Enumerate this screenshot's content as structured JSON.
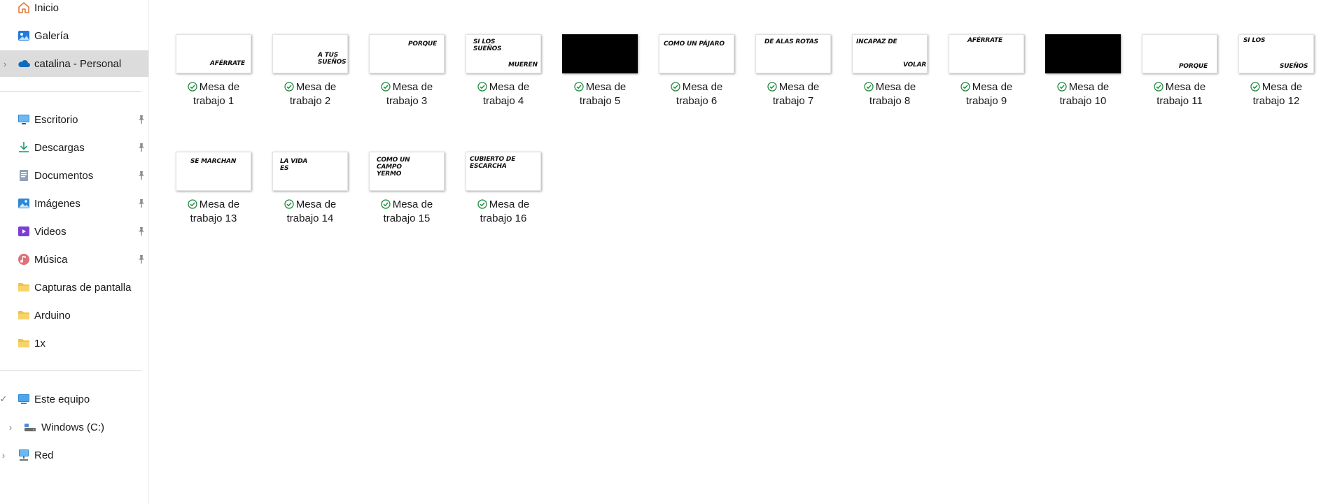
{
  "sidebar": {
    "top_items": [
      {
        "label": "Inicio",
        "icon": "home-icon"
      },
      {
        "label": "Galería",
        "icon": "gallery-icon"
      },
      {
        "label": "catalina - Personal",
        "icon": "onedrive-cloud-icon",
        "selected": true
      }
    ],
    "pinned_items": [
      {
        "label": "Escritorio",
        "icon": "desktop-icon"
      },
      {
        "label": "Descargas",
        "icon": "download-icon"
      },
      {
        "label": "Documentos",
        "icon": "documents-icon"
      },
      {
        "label": "Imágenes",
        "icon": "pictures-icon"
      },
      {
        "label": "Videos",
        "icon": "videos-icon"
      },
      {
        "label": "Música",
        "icon": "music-icon"
      }
    ],
    "folders": [
      {
        "label": "Capturas de pantalla",
        "icon": "folder-icon"
      },
      {
        "label": "Arduino",
        "icon": "folder-icon"
      },
      {
        "label": "1x",
        "icon": "folder-icon"
      }
    ],
    "devices": [
      {
        "label": "Este equipo",
        "icon": "computer-icon",
        "chevron": "✓"
      },
      {
        "label": "Windows (C:)",
        "icon": "drive-icon",
        "chevron": "›"
      },
      {
        "label": "Red",
        "icon": "network-icon",
        "chevron": "›"
      }
    ]
  },
  "files": [
    {
      "name_line1": "Mesa de",
      "name_line2": "trabajo 1",
      "thumb_text": "AFÉRRATE",
      "dark": false
    },
    {
      "name_line1": "Mesa de",
      "name_line2": "trabajo 2",
      "thumb_text": "A TUS\nSUEÑOS",
      "dark": false
    },
    {
      "name_line1": "Mesa de",
      "name_line2": "trabajo 3",
      "thumb_text": "PORQUE",
      "dark": false
    },
    {
      "name_line1": "Mesa de",
      "name_line2": "trabajo 4",
      "thumb_text": "SI LOS\nSUEÑOS",
      "thumb_text2": "MUEREN",
      "dark": false
    },
    {
      "name_line1": "Mesa de",
      "name_line2": "trabajo 5",
      "thumb_text": "",
      "dark": true
    },
    {
      "name_line1": "Mesa de",
      "name_line2": "trabajo 6",
      "thumb_text": "COMO UN PÁJARO",
      "dark": false
    },
    {
      "name_line1": "Mesa de",
      "name_line2": "trabajo 7",
      "thumb_text": "DE ALAS ROTAS",
      "dark": false
    },
    {
      "name_line1": "Mesa de",
      "name_line2": "trabajo 8",
      "thumb_text": "INCAPAZ DE",
      "thumb_text2": "VOLAR",
      "dark": false
    },
    {
      "name_line1": "Mesa de",
      "name_line2": "trabajo 9",
      "thumb_text": "AFÉRRATE",
      "dark": false
    },
    {
      "name_line1": "Mesa de",
      "name_line2": "trabajo 10",
      "thumb_text": "",
      "dark": true
    },
    {
      "name_line1": "Mesa de",
      "name_line2": "trabajo 11",
      "thumb_text": "PORQUE",
      "dark": false
    },
    {
      "name_line1": "Mesa de",
      "name_line2": "trabajo 12",
      "thumb_text": "SI LOS",
      "thumb_text2": "SUEÑOS",
      "dark": false
    },
    {
      "name_line1": "Mesa de",
      "name_line2": "trabajo 13",
      "thumb_text": "SE MARCHAN",
      "dark": false
    },
    {
      "name_line1": "Mesa de",
      "name_line2": "trabajo 14",
      "thumb_text": "LA VIDA\nES",
      "dark": false
    },
    {
      "name_line1": "Mesa de",
      "name_line2": "trabajo 15",
      "thumb_text": "COMO UN\nCAMPO\nYERMO",
      "dark": false
    },
    {
      "name_line1": "Mesa de",
      "name_line2": "trabajo 16",
      "thumb_text": "CUBIERTO DE\nESCARCHA",
      "dark": false
    }
  ],
  "colors": {
    "selected_bg": "#dcdcdc",
    "sync_ok": "#1e8a3c",
    "folder_yellow": "#f2c14b",
    "onedrive_blue": "#0f6cbd"
  }
}
